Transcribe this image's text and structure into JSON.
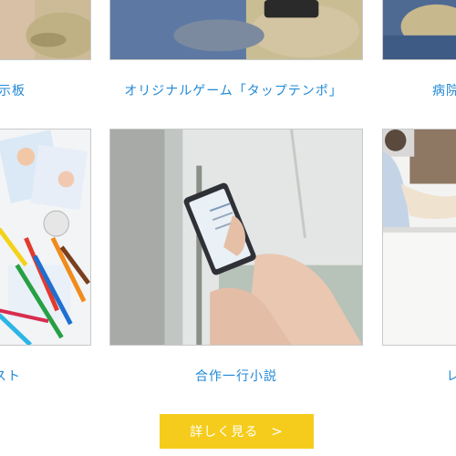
{
  "cards": {
    "top_left": {
      "label": "示板"
    },
    "top_center": {
      "label": "オリジナルゲーム「タップテンポ」"
    },
    "top_right": {
      "label": "病院"
    },
    "bottom_left": {
      "label": "スト"
    },
    "bottom_center": {
      "label": "合作一行小説"
    },
    "bottom_right": {
      "label": "レ"
    }
  },
  "more_button": {
    "label": "詳しく見る",
    "arrow": ">"
  },
  "colors": {
    "link_blue": "#2189d6",
    "button_yellow": "#f6cc1c",
    "card_border": "#c9c9c9"
  }
}
